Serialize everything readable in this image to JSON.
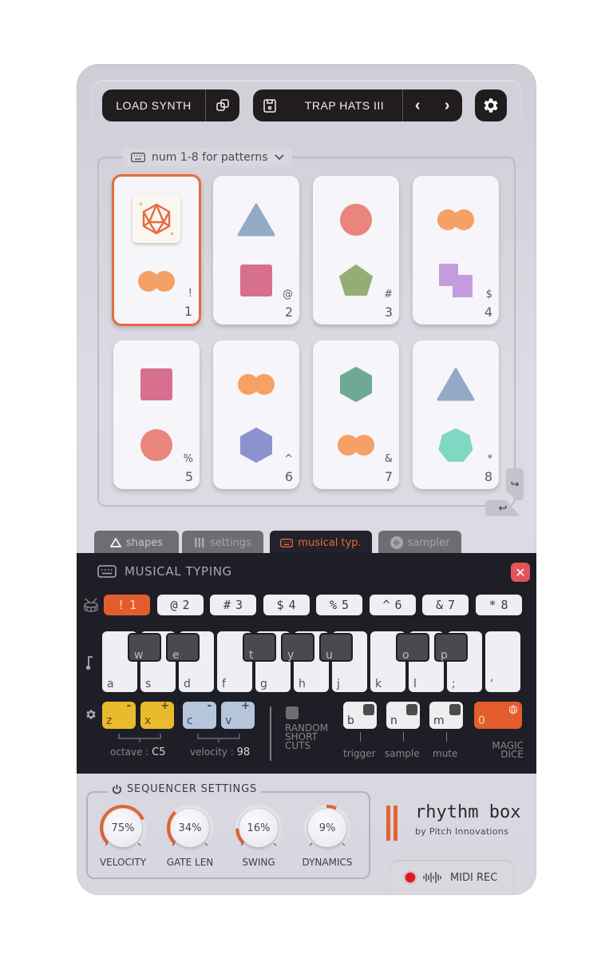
{
  "toolbar": {
    "load_synth": "LOAD SYNTH",
    "preset_name": "TRAP HATS III",
    "prev": "‹",
    "next": "›"
  },
  "patterns": {
    "header": "num 1-8 for patterns",
    "cards": [
      {
        "num": "1",
        "sym": "!",
        "top": "dice",
        "bottom": "double-circle",
        "active": true
      },
      {
        "num": "2",
        "sym": "@",
        "top": "triangle",
        "bottom": "square"
      },
      {
        "num": "3",
        "sym": "#",
        "top": "circle",
        "bottom": "pentagon"
      },
      {
        "num": "4",
        "sym": "$",
        "top": "double-circle",
        "bottom": "double-square"
      },
      {
        "num": "5",
        "sym": "%",
        "top": "square",
        "bottom": "circle"
      },
      {
        "num": "6",
        "sym": "^",
        "top": "double-circle",
        "bottom": "hexagon"
      },
      {
        "num": "7",
        "sym": "&",
        "top": "hexagon",
        "bottom": "double-circle"
      },
      {
        "num": "8",
        "sym": "*",
        "top": "triangle",
        "bottom": "heptagon"
      }
    ],
    "colors": {
      "triangle": "#93a9c6",
      "square": "#d7708e",
      "circle": "#e9857b",
      "pentagon": "#94ad76",
      "double-circle": "#f5a064",
      "double-square": "#c49bdd",
      "hexagon-6": "#8b93cc",
      "hexagon-7": "#6fa995",
      "heptagon": "#7fd9c2",
      "accent": "#e56b3e"
    }
  },
  "tabs": [
    {
      "label": "shapes",
      "icon": "triangle-icon"
    },
    {
      "label": "settings",
      "icon": "bars-icon"
    },
    {
      "label": "musical typ.",
      "icon": "keyboard-icon",
      "active": true
    },
    {
      "label": "sampler",
      "icon": "waveform-icon"
    }
  ],
  "musical_typing": {
    "title": "MUSICAL TYPING",
    "pattern_keys": [
      {
        "sym": "!",
        "num": "1",
        "active": true
      },
      {
        "sym": "@",
        "num": "2"
      },
      {
        "sym": "#",
        "num": "3"
      },
      {
        "sym": "$",
        "num": "4"
      },
      {
        "sym": "%",
        "num": "5"
      },
      {
        "sym": "^",
        "num": "6"
      },
      {
        "sym": "&",
        "num": "7"
      },
      {
        "sym": "*",
        "num": "8"
      }
    ],
    "white_keys": [
      "a",
      "s",
      "d",
      "f",
      "g",
      "h",
      "j",
      "k",
      "l",
      ";",
      "‘"
    ],
    "black_keys": [
      "w",
      "e",
      "t",
      "y",
      "u",
      "o",
      "p"
    ],
    "octave": {
      "down": "z",
      "up": "x",
      "minus": "-",
      "plus": "+",
      "label": "octave :",
      "value": "C5"
    },
    "velocity": {
      "down": "c",
      "up": "v",
      "minus": "-",
      "plus": "+",
      "label": "velocity :",
      "value": "98"
    },
    "random_label": [
      "RANDOM",
      "SHORT",
      "CUTS"
    ],
    "random_keys": [
      {
        "key": "b",
        "label": "trigger"
      },
      {
        "key": "n",
        "label": "sample"
      },
      {
        "key": "m",
        "label": "mute"
      }
    ],
    "magic": {
      "key": "0",
      "label": [
        "MAGIC",
        "DICE"
      ]
    }
  },
  "sequencer": {
    "title": "SEQUENCER SETTINGS",
    "knobs": [
      {
        "label": "VELOCITY",
        "value": "75%",
        "fraction": 0.75
      },
      {
        "label": "GATE LEN",
        "value": "34%",
        "fraction": 0.34
      },
      {
        "label": "SWING",
        "value": "16%",
        "fraction": 0.16
      },
      {
        "label": "DYNAMICS",
        "value": "9%",
        "fraction": 0.09,
        "bipolar": true
      }
    ]
  },
  "brand": {
    "name": "rhythm box",
    "by": "by Pitch Innovations"
  },
  "midi_rec": {
    "label": "MIDI REC"
  }
}
